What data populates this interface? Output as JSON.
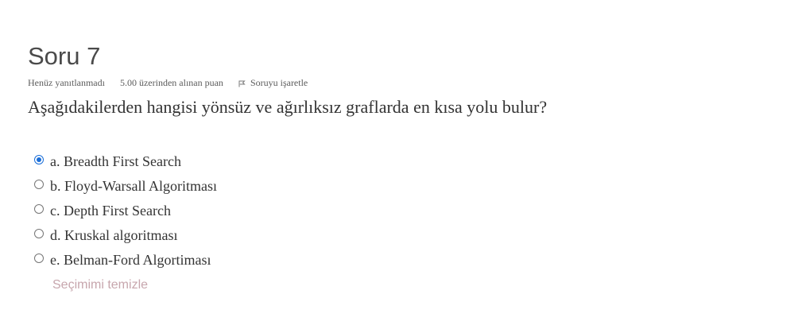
{
  "question": {
    "title": "Soru 7",
    "state": "Henüz yanıtlanmadı",
    "grade": "5.00 üzerinden alınan puan",
    "flag_label": "Soruyu işaretle",
    "flag_icon": "flag-icon",
    "text": "Aşağıdakilerden hangisi yönsüz ve ağırlıksız graflarda en kısa yolu bulur?"
  },
  "answers": [
    {
      "label": "a. Breadth First Search",
      "selected": true
    },
    {
      "label": "b. Floyd-Warsall Algoritması",
      "selected": false
    },
    {
      "label": "c. Depth First Search",
      "selected": false
    },
    {
      "label": "d. Kruskal algoritması",
      "selected": false
    },
    {
      "label": "e. Belman-Ford Algortiması",
      "selected": false
    }
  ],
  "clear_choice": "Seçimimi temizle",
  "colors": {
    "radio_selected": "#1a6ed8",
    "clear_link": "#c7a6ad"
  }
}
